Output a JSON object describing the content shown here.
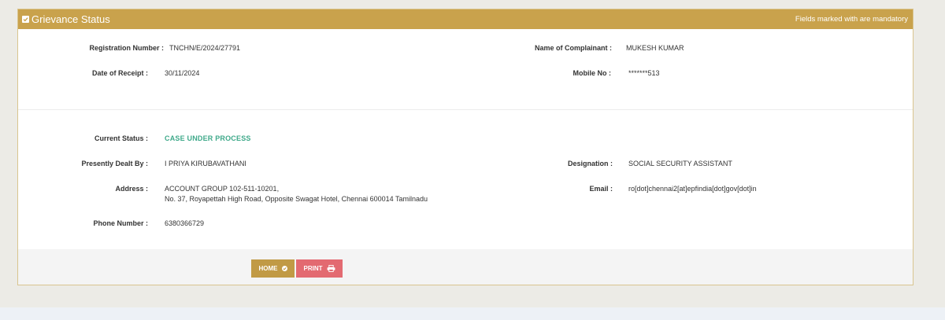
{
  "panel": {
    "title": "Grievance Status",
    "mandatory_note": "Fields marked with   are mandatory"
  },
  "fields": {
    "registration_number": {
      "label": "Registration Number :",
      "value": "TNCHN/E/2024/27791"
    },
    "name_of_complainant": {
      "label": "Name of Complainant :",
      "value": "MUKESH KUMAR"
    },
    "date_of_receipt": {
      "label": "Date of Receipt :",
      "value": "30/11/2024"
    },
    "mobile_no": {
      "label": "Mobile No :",
      "value": "*******513"
    },
    "current_status": {
      "label": "Current Status :",
      "value": "CASE UNDER PROCESS"
    },
    "presently_dealt_by": {
      "label": "Presently Dealt By :",
      "value": "I PRIYA KIRUBAVATHANI"
    },
    "designation": {
      "label": "Designation :",
      "value": "SOCIAL SECURITY ASSISTANT"
    },
    "address": {
      "label": "Address :",
      "line1": "ACCOUNT GROUP 102-511-10201,",
      "line2": "No. 37, Royapettah High Road, Opposite Swagat Hotel, Chennai 600014 Tamilnadu"
    },
    "email": {
      "label": "Email :",
      "value": "ro[dot]chennai2[at]epfindia[dot]gov[dot]in"
    },
    "phone_number": {
      "label": "Phone Number :",
      "value": "6380366729"
    }
  },
  "buttons": {
    "home": {
      "label": "HOME",
      "icon": "check-circle-icon"
    },
    "print": {
      "label": "PRINT",
      "icon": "printer-icon"
    }
  },
  "colors": {
    "header": "#c9a24c",
    "status": "#3fa98a",
    "home_button": "#c19a45",
    "print_button": "#e36a71"
  }
}
